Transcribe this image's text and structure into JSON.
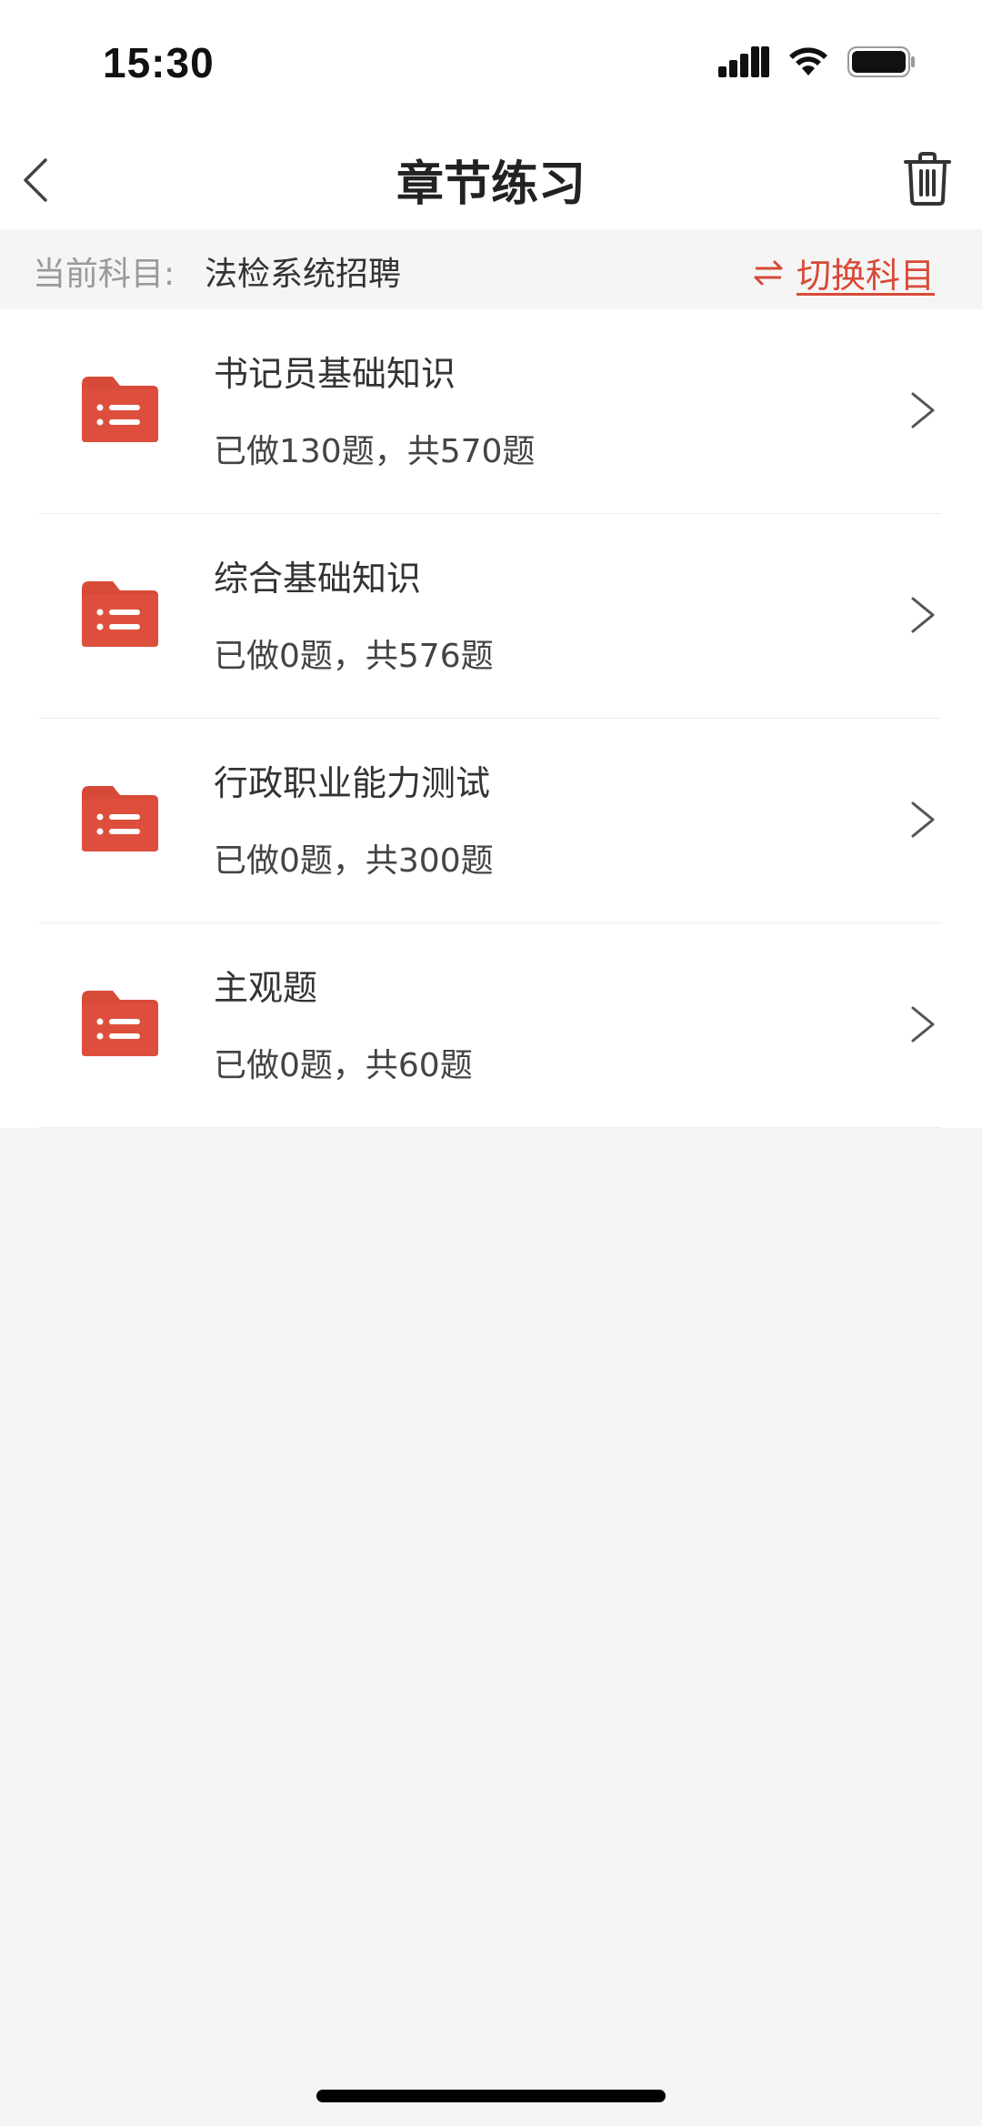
{
  "status_bar": {
    "time": "15:30",
    "icons": [
      "signal-icon",
      "wifi-icon",
      "battery-icon"
    ]
  },
  "nav": {
    "title": "章节练习",
    "back_icon": "chevron-left-icon",
    "delete_icon": "trash-icon"
  },
  "subject": {
    "label": "当前科目:",
    "value": "法检系统招聘",
    "switch_label": "切换科目",
    "switch_icon": "swap-arrows-icon"
  },
  "chapters": [
    {
      "title": "书记员基础知识",
      "progress": "已做130题，共570题",
      "icon": "folder-list-icon"
    },
    {
      "title": "综合基础知识",
      "progress": "已做0题，共576题",
      "icon": "folder-list-icon"
    },
    {
      "title": "行政职业能力测试",
      "progress": "已做0题，共300题",
      "icon": "folder-list-icon"
    },
    {
      "title": "主观题",
      "progress": "已做0题，共60题",
      "icon": "folder-list-icon"
    }
  ],
  "colors": {
    "accent": "#d84a38",
    "background": "#f5f5f5",
    "card": "#ffffff"
  }
}
